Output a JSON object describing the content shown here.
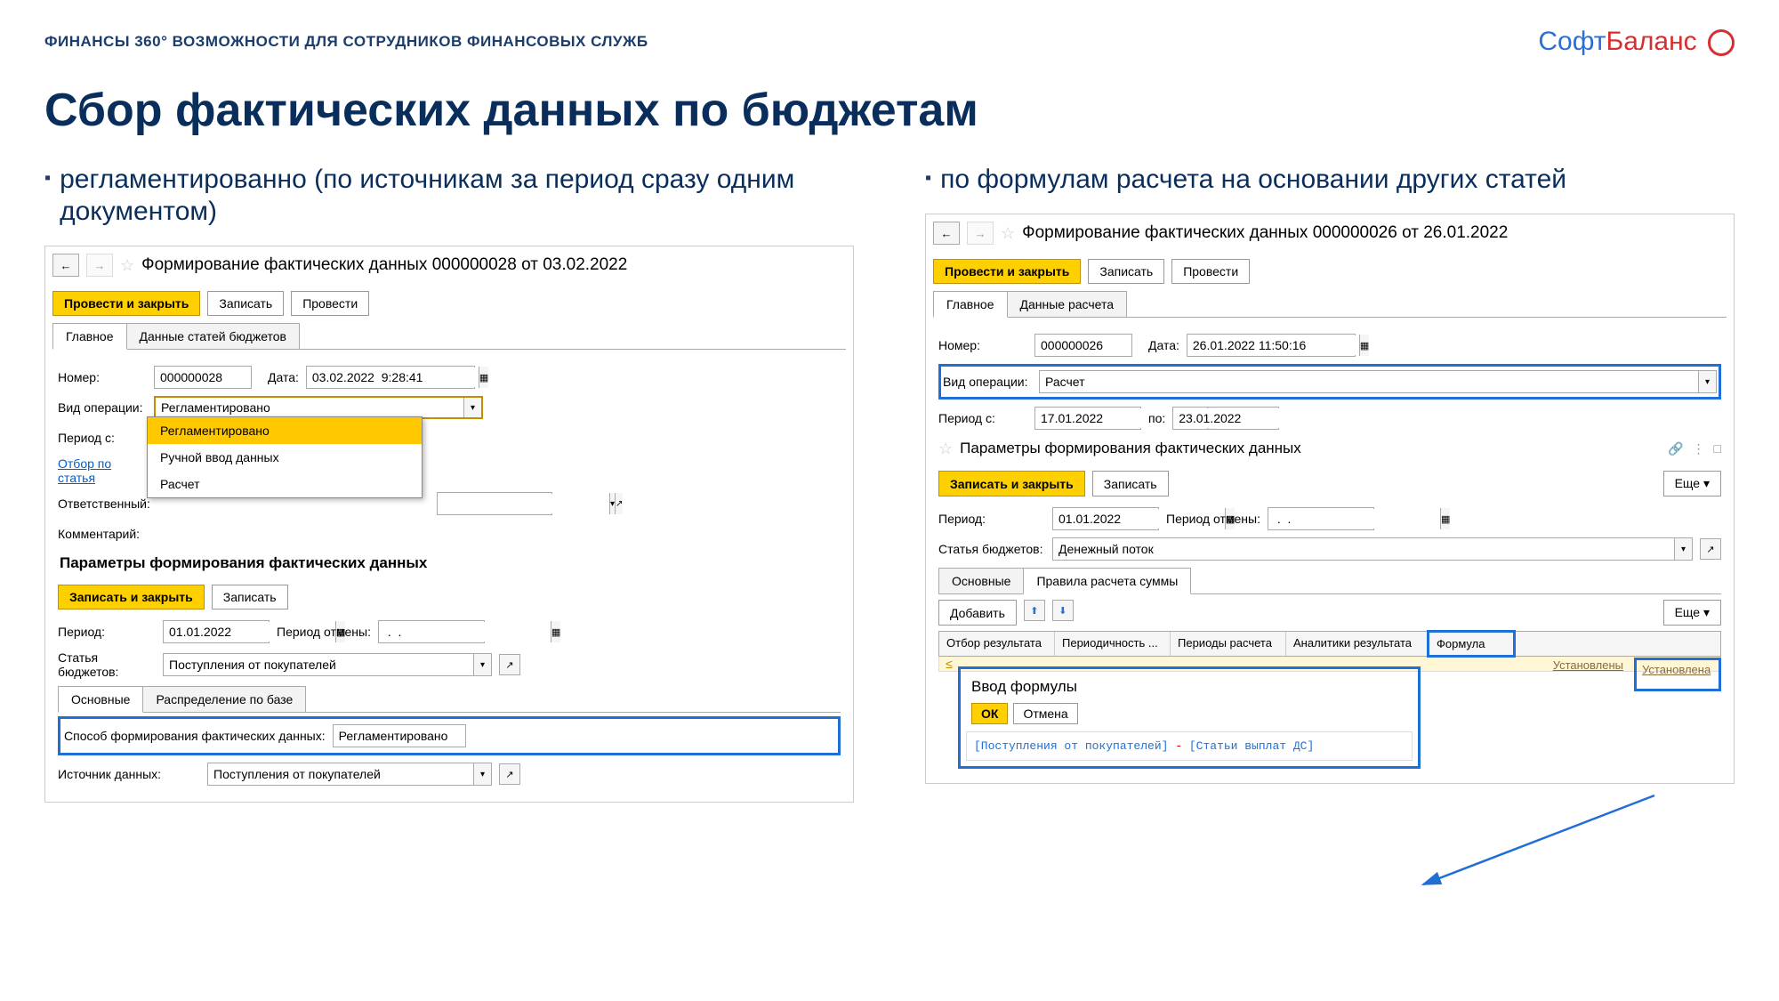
{
  "header": {
    "text": "ФИНАНСЫ 360° ВОЗМОЖНОСТИ ДЛЯ СОТРУДНИКОВ ФИНАНСОВЫХ СЛУЖБ",
    "logo_soft": "Софт",
    "logo_balance": "Баланс"
  },
  "main_title": "Сбор фактических данных по бюджетам",
  "left": {
    "bullet": "регламентированно (по источникам за период сразу одним документом)",
    "window_title": "Формирование фактических данных 000000028 от 03.02.2022",
    "btn_post_close": "Провести и закрыть",
    "btn_write": "Записать",
    "btn_post": "Провести",
    "tab_main": "Главное",
    "tab_data": "Данные статей бюджетов",
    "lbl_number": "Номер:",
    "val_number": "000000028",
    "lbl_date": "Дата:",
    "val_date": "03.02.2022  9:28:41",
    "lbl_op_type": "Вид операции:",
    "val_op_type": "Регламентировано",
    "lbl_period": "Период с:",
    "dd_items": [
      "Регламентировано",
      "Ручной ввод данных",
      "Расчет"
    ],
    "lbl_selection": "Отбор по статья",
    "lbl_responsible": "Ответственный:",
    "lbl_comment": "Комментарий:",
    "sub_title": "Параметры формирования фактических данных",
    "btn_save_close": "Записать и закрыть",
    "lbl_period2": "Период:",
    "val_period2": "01.01.2022",
    "lbl_period_cancel": "Период отмены:",
    "val_period_cancel": " .  .    ",
    "lbl_article": "Статья бюджетов:",
    "val_article": "Поступления от покупателей",
    "tab_basic": "Основные",
    "tab_dist": "Распределение по базе",
    "lbl_method": "Способ формирования фактических данных:",
    "val_method": "Регламентировано",
    "lbl_source": "Источник данных:",
    "val_source": "Поступления от покупателей"
  },
  "right": {
    "bullet": "по формулам расчета на основании других статей",
    "window_title": "Формирование фактических данных 000000026 от 26.01.2022",
    "btn_post_close": "Провести и закрыть",
    "btn_write": "Записать",
    "btn_post": "Провести",
    "tab_main": "Главное",
    "tab_data": "Данные расчета",
    "lbl_number": "Номер:",
    "val_number": "000000026",
    "lbl_date": "Дата:",
    "val_date": "26.01.2022 11:50:16",
    "lbl_op_type": "Вид операции:",
    "val_op_type": "Расчет",
    "lbl_period_from": "Период с:",
    "val_period_from": "17.01.2022",
    "lbl_period_to": "по:",
    "val_period_to": "23.01.2022",
    "sub_title": "Параметры формирования фактических данных",
    "btn_save_close": "Записать и закрыть",
    "btn_more": "Еще",
    "lbl_period2": "Период:",
    "val_period2": "01.01.2022",
    "lbl_period_cancel": "Период отмены:",
    "val_period_cancel": " .  .    ",
    "lbl_article": "Статья бюджетов:",
    "val_article": "Денежный поток",
    "tab_basic": "Основные",
    "tab_rules": "Правила расчета суммы",
    "btn_add": "Добавить",
    "th_sel": "Отбор результата",
    "th_period": "Периодичность ...",
    "th_calc_periods": "Периоды расчета",
    "th_analytics": "Аналитики результата",
    "th_formula": "Формула",
    "val_analytics": "Установлены",
    "val_formula": "Установлена",
    "formula_title": "Ввод формулы",
    "btn_ok": "ОК",
    "btn_cancel": "Отмена",
    "formula_a": "[Поступления от покупателей]",
    "formula_op": " - ",
    "formula_b": "[Статьи выплат ДС]"
  }
}
